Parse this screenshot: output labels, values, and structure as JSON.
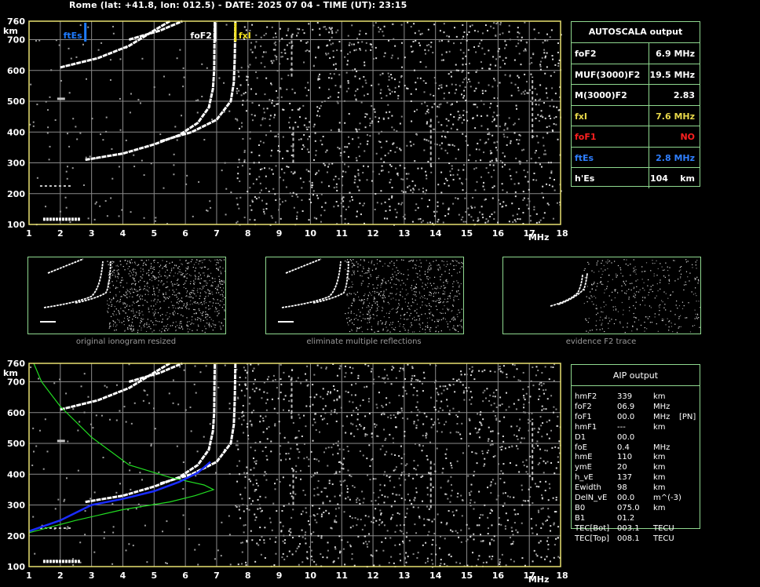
{
  "header": {
    "title": "Rome (lat: +41.8, lon: 012.5) - DATE: 2025 07 04 - TIME (UT): 23:15"
  },
  "ionogram": {
    "y_unit": "km",
    "x_unit": "MHz",
    "y_ticks": [
      "760",
      "700",
      "600",
      "500",
      "400",
      "300",
      "200",
      "100"
    ],
    "x_ticks": [
      "1",
      "2",
      "3",
      "4",
      "5",
      "6",
      "7",
      "8",
      "9",
      "10",
      "11",
      "12",
      "13",
      "14",
      "15",
      "16",
      "17",
      "18"
    ],
    "markers": {
      "ftEs": {
        "label": "ftEs",
        "color": "#1e7bff"
      },
      "foF2": {
        "label": "foF2",
        "color": "#ffffff"
      },
      "fxI": {
        "label": "fxI",
        "color": "#f0e020"
      }
    }
  },
  "autoscala": {
    "title": "AUTOSCALA output",
    "rows": [
      {
        "label": "foF2",
        "value": "6.9 MHz",
        "color": "#ffffff"
      },
      {
        "label": "MUF(3000)F2",
        "value": "19.5 MHz",
        "color": "#ffffff"
      },
      {
        "label": "M(3000)F2",
        "value": "2.83",
        "color": "#ffffff"
      },
      {
        "label": "fxI",
        "value": "7.6 MHz",
        "color": "#e8d84a"
      },
      {
        "label": "foF1",
        "value": "NO",
        "color": "#ff2020"
      },
      {
        "label": "ftEs",
        "value": "2.8 MHz",
        "color": "#2f7fff"
      },
      {
        "label": "h'Es",
        "value": "104    km",
        "color": "#ffffff"
      }
    ]
  },
  "thumbnails": [
    {
      "caption": "original ionogram resized"
    },
    {
      "caption": "eliminate multiple reflections"
    },
    {
      "caption": "evidence F2 trace"
    }
  ],
  "aip": {
    "title": "AIP output",
    "rows": [
      {
        "label": "hmF2",
        "value": "339",
        "unit": "km",
        "extra": ""
      },
      {
        "label": "foF2",
        "value": "06.9",
        "unit": "MHz",
        "extra": ""
      },
      {
        "label": "foF1",
        "value": "00.0",
        "unit": "MHz",
        "extra": "[PN]"
      },
      {
        "label": "hmF1",
        "value": "---",
        "unit": "km",
        "extra": ""
      },
      {
        "label": "D1",
        "value": "00.0",
        "unit": "",
        "extra": ""
      },
      {
        "label": "foE",
        "value": "0.4",
        "unit": "MHz",
        "extra": ""
      },
      {
        "label": "hmE",
        "value": "110",
        "unit": "km",
        "extra": ""
      },
      {
        "label": "ymE",
        "value": "20",
        "unit": "km",
        "extra": ""
      },
      {
        "label": "h_vE",
        "value": "137",
        "unit": "km",
        "extra": ""
      },
      {
        "label": "Ewidth",
        "value": "98",
        "unit": "km",
        "extra": ""
      },
      {
        "label": "DelN_vE",
        "value": "00.0",
        "unit": "m^(-3)",
        "extra": ""
      },
      {
        "label": "B0",
        "value": "075.0",
        "unit": "km",
        "extra": ""
      },
      {
        "label": "B1",
        "value": "01.2",
        "unit": "",
        "extra": ""
      },
      {
        "label": "TEC[Bot]",
        "value": "003.1",
        "unit": "TECU",
        "extra": ""
      },
      {
        "label": "TEC[Top]",
        "value": "008.1",
        "unit": "TECU",
        "extra": ""
      }
    ]
  },
  "colors": {
    "grid": "#8a8a8a",
    "frame": "#e8e070",
    "border": "#8fd88f",
    "trace": "#ffffff",
    "profile_green": "#22dd22",
    "profile_blue": "#1a2cff"
  }
}
